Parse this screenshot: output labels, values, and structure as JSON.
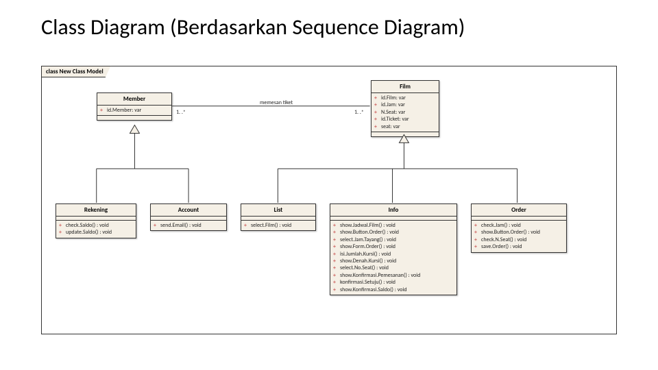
{
  "title": "Class Diagram (Berdasarkan Sequence Diagram)",
  "frame_label": "class New Class Model",
  "association": {
    "label": "memesan tiket",
    "mult_left": "1. .*",
    "mult_right": "1. .*"
  },
  "classes": {
    "member": {
      "name": "Member",
      "attrs": [
        {
          "vis": "+",
          "sig": "id.Member: var"
        }
      ],
      "ops": []
    },
    "film": {
      "name": "Film",
      "attrs": [
        {
          "vis": "+",
          "sig": "id.Film: var"
        },
        {
          "vis": "+",
          "sig": "id.Jam: var"
        },
        {
          "vis": "+",
          "sig": "N.Seat: var"
        },
        {
          "vis": "+",
          "sig": "id.Ticket: var"
        },
        {
          "vis": "+",
          "sig": "seat: var"
        }
      ],
      "ops": []
    },
    "rekening": {
      "name": "Rekening",
      "attrs": [],
      "ops": [
        {
          "vis": "+",
          "sig": "check.Saldo() : void"
        },
        {
          "vis": "+",
          "sig": "update.Saldo() : void"
        }
      ]
    },
    "account": {
      "name": "Account",
      "attrs": [],
      "ops": [
        {
          "vis": "+",
          "sig": "send.Email() : void"
        }
      ]
    },
    "list": {
      "name": "List",
      "attrs": [],
      "ops": [
        {
          "vis": "+",
          "sig": "select.Film() : void"
        }
      ]
    },
    "info": {
      "name": "Info",
      "attrs": [],
      "ops": [
        {
          "vis": "+",
          "sig": "show.Jadwal.Film() : void"
        },
        {
          "vis": "+",
          "sig": "show.Button.Order() : void"
        },
        {
          "vis": "+",
          "sig": "select.Jam.Tayang() : void"
        },
        {
          "vis": "+",
          "sig": "show.Form.Order() : void"
        },
        {
          "vis": "+",
          "sig": "isi.Jumlah.Kursi() : void"
        },
        {
          "vis": "+",
          "sig": "show.Denah.Kursi() : void"
        },
        {
          "vis": "+",
          "sig": "select.No.Seat() : void"
        },
        {
          "vis": "+",
          "sig": "show.Konfirmasi.Pemesanan() : void"
        },
        {
          "vis": "+",
          "sig": "konfirmasi.Setuju() : void"
        },
        {
          "vis": "+",
          "sig": "show.Konfirmasi.Saldo() : void"
        }
      ]
    },
    "order": {
      "name": "Order",
      "attrs": [],
      "ops": [
        {
          "vis": "+",
          "sig": "check.Jam() : void"
        },
        {
          "vis": "+",
          "sig": "show.Button.Order() : void"
        },
        {
          "vis": "+",
          "sig": "check.N.Seat() : void"
        },
        {
          "vis": "+",
          "sig": "save.Order() : void"
        }
      ]
    }
  }
}
